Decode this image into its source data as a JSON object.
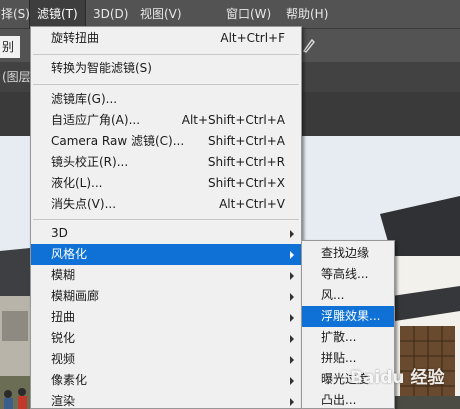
{
  "menubar": {
    "items": [
      {
        "label": "择(S)"
      },
      {
        "label": "滤镜(T)"
      },
      {
        "label": "3D(D)"
      },
      {
        "label": "视图(V)"
      },
      {
        "label": "窗口(W)"
      },
      {
        "label": "帮助(H)"
      }
    ]
  },
  "options_bar": {
    "field_text": "别"
  },
  "document_tab": {
    "label": "(图层"
  },
  "filter_menu": {
    "items": [
      {
        "label": "旋转扭曲",
        "shortcut": "Alt+Ctrl+F"
      },
      {
        "label": "转换为智能滤镜(S)",
        "shortcut": ""
      },
      {
        "label": "滤镜库(G)...",
        "shortcut": ""
      },
      {
        "label": "自适应广角(A)...",
        "shortcut": "Alt+Shift+Ctrl+A"
      },
      {
        "label": "Camera Raw 滤镜(C)...",
        "shortcut": "Shift+Ctrl+A"
      },
      {
        "label": "镜头校正(R)...",
        "shortcut": "Shift+Ctrl+R"
      },
      {
        "label": "液化(L)...",
        "shortcut": "Shift+Ctrl+X"
      },
      {
        "label": "消失点(V)...",
        "shortcut": "Alt+Ctrl+V"
      },
      {
        "label": "3D",
        "shortcut": ""
      },
      {
        "label": "风格化",
        "shortcut": ""
      },
      {
        "label": "模糊",
        "shortcut": ""
      },
      {
        "label": "模糊画廊",
        "shortcut": ""
      },
      {
        "label": "扭曲",
        "shortcut": ""
      },
      {
        "label": "锐化",
        "shortcut": ""
      },
      {
        "label": "视频",
        "shortcut": ""
      },
      {
        "label": "像素化",
        "shortcut": ""
      },
      {
        "label": "渲染",
        "shortcut": ""
      }
    ]
  },
  "stylize_submenu": {
    "items": [
      {
        "label": "查找边缘"
      },
      {
        "label": "等高线..."
      },
      {
        "label": "风..."
      },
      {
        "label": "浮雕效果..."
      },
      {
        "label": "扩散..."
      },
      {
        "label": "拼贴..."
      },
      {
        "label": "曝光过度"
      },
      {
        "label": "凸出..."
      }
    ]
  },
  "watermark": {
    "text": "Baidu 经验"
  },
  "colors": {
    "highlight": "#0f71d6",
    "menu_bg": "#f0f0f0",
    "menubar_bg": "#535353"
  }
}
